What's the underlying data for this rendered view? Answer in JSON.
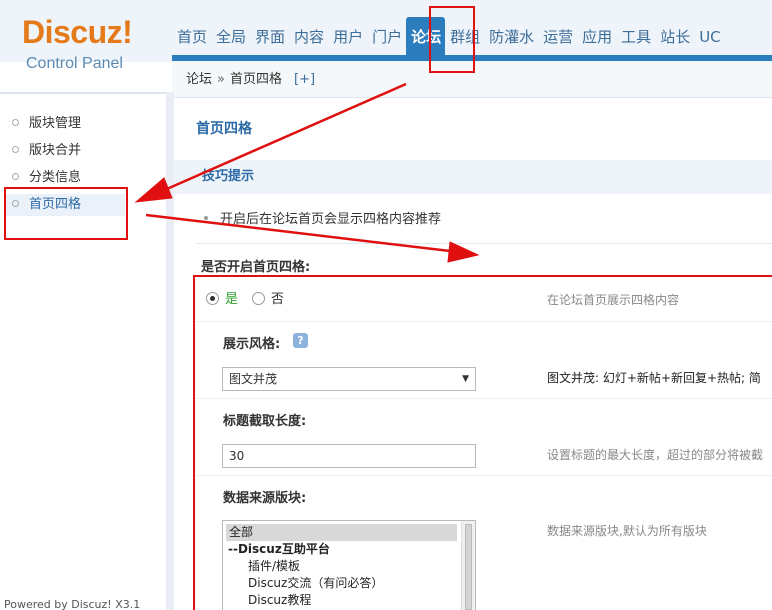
{
  "header": {
    "logo_text": "Discuz!",
    "logo_sub": "Control Panel",
    "nav": [
      "首页",
      "全局",
      "界面",
      "内容",
      "用户",
      "门户",
      "论坛",
      "群组",
      "防灌水",
      "运营",
      "应用",
      "工具",
      "站长",
      "UC"
    ],
    "active_index": 6
  },
  "breadcrumb": {
    "root": "论坛",
    "separator": "»",
    "current": "首页四格",
    "plus": "[+]"
  },
  "sidebar": {
    "items": [
      {
        "label": "版块管理"
      },
      {
        "label": "版块合并"
      },
      {
        "label": "分类信息"
      },
      {
        "label": "首页四格"
      }
    ],
    "active_index": 3,
    "powered": "Powered by Discuz! X3.1"
  },
  "main": {
    "title": "首页四格",
    "tips_title": "技巧提示",
    "tip": "开启后在论坛首页会显示四格内容推荐",
    "enable": {
      "label": "是否开启首页四格:",
      "yes": "是",
      "no": "否",
      "value": "是",
      "hint": "在论坛首页展示四格内容"
    },
    "style": {
      "label": "展示风格:",
      "help": "?",
      "value": "图文并茂",
      "hint": "图文并茂: 幻灯+新帖+新回复+热帖; 简"
    },
    "title_length": {
      "label": "标题截取长度:",
      "value": "30",
      "hint": "设置标题的最大长度，超过的部分将被截"
    },
    "source": {
      "label": "数据来源版块:",
      "hint": "数据来源版块,默认为所有版块",
      "options": [
        "全部",
        "--Discuz互助平台",
        "插件/模板",
        "Discuz交流（有问必答）",
        "Discuz教程"
      ]
    }
  },
  "colors": {
    "nav_active": "#2b7dbd",
    "link_blue": "#2b6aa6",
    "logo_orange": "#e57a1b",
    "annotation_red": "#e01010"
  }
}
